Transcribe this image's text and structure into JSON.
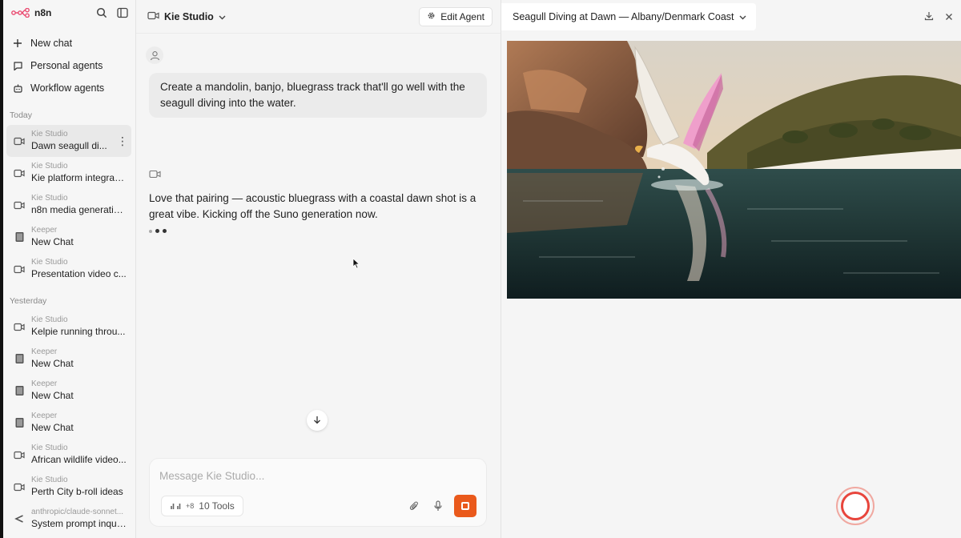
{
  "app": {
    "logo_text": "n8n"
  },
  "sidebar": {
    "nav": [
      {
        "label": "New chat",
        "icon": "plus-icon"
      },
      {
        "label": "Personal agents",
        "icon": "chat-bubble-icon"
      },
      {
        "label": "Workflow agents",
        "icon": "robot-icon"
      }
    ],
    "sections": [
      {
        "label": "Today"
      },
      {
        "label": "Yesterday"
      }
    ],
    "today": [
      {
        "agent": "Kie Studio",
        "title": "Dawn seagull di...",
        "icon": "video-icon",
        "active": true
      },
      {
        "agent": "Kie Studio",
        "title": "Kie platform integrati...",
        "icon": "video-icon"
      },
      {
        "agent": "Kie Studio",
        "title": "n8n media generatio...",
        "icon": "video-icon"
      },
      {
        "agent": "Keeper",
        "title": "New Chat",
        "icon": "book-icon"
      },
      {
        "agent": "Kie Studio",
        "title": "Presentation video c...",
        "icon": "video-icon"
      }
    ],
    "yesterday": [
      {
        "agent": "Kie Studio",
        "title": "Kelpie running throu...",
        "icon": "video-icon"
      },
      {
        "agent": "Keeper",
        "title": "New Chat",
        "icon": "book-icon"
      },
      {
        "agent": "Keeper",
        "title": "New Chat",
        "icon": "book-icon"
      },
      {
        "agent": "Keeper",
        "title": "New Chat",
        "icon": "book-icon"
      },
      {
        "agent": "Kie Studio",
        "title": "African wildlife video...",
        "icon": "video-icon"
      },
      {
        "agent": "Kie Studio",
        "title": "Perth City b-roll ideas",
        "icon": "video-icon"
      },
      {
        "agent": "anthropic/claude-sonnet...",
        "title": "System prompt inquiry",
        "icon": "claude-icon"
      }
    ]
  },
  "chat": {
    "agent_name": "Kie Studio",
    "edit_agent_label": "Edit Agent",
    "user_message": "Create a mandolin, banjo, bluegrass track that'll go well with the seagull diving into the water.",
    "agent_message": "Love that pairing — acoustic bluegrass with a coastal dawn shot is a great vibe. Kicking off the Suno generation now.",
    "composer": {
      "placeholder": "Message Kie Studio...",
      "tools_extra": "+8",
      "tools_label": "10 Tools"
    }
  },
  "preview": {
    "title": "Seagull Diving at Dawn — Albany/Denmark Coast"
  },
  "colors": {
    "accent": "#ea5a1c",
    "record": "#e8453c",
    "logo": "#ea4b71"
  }
}
